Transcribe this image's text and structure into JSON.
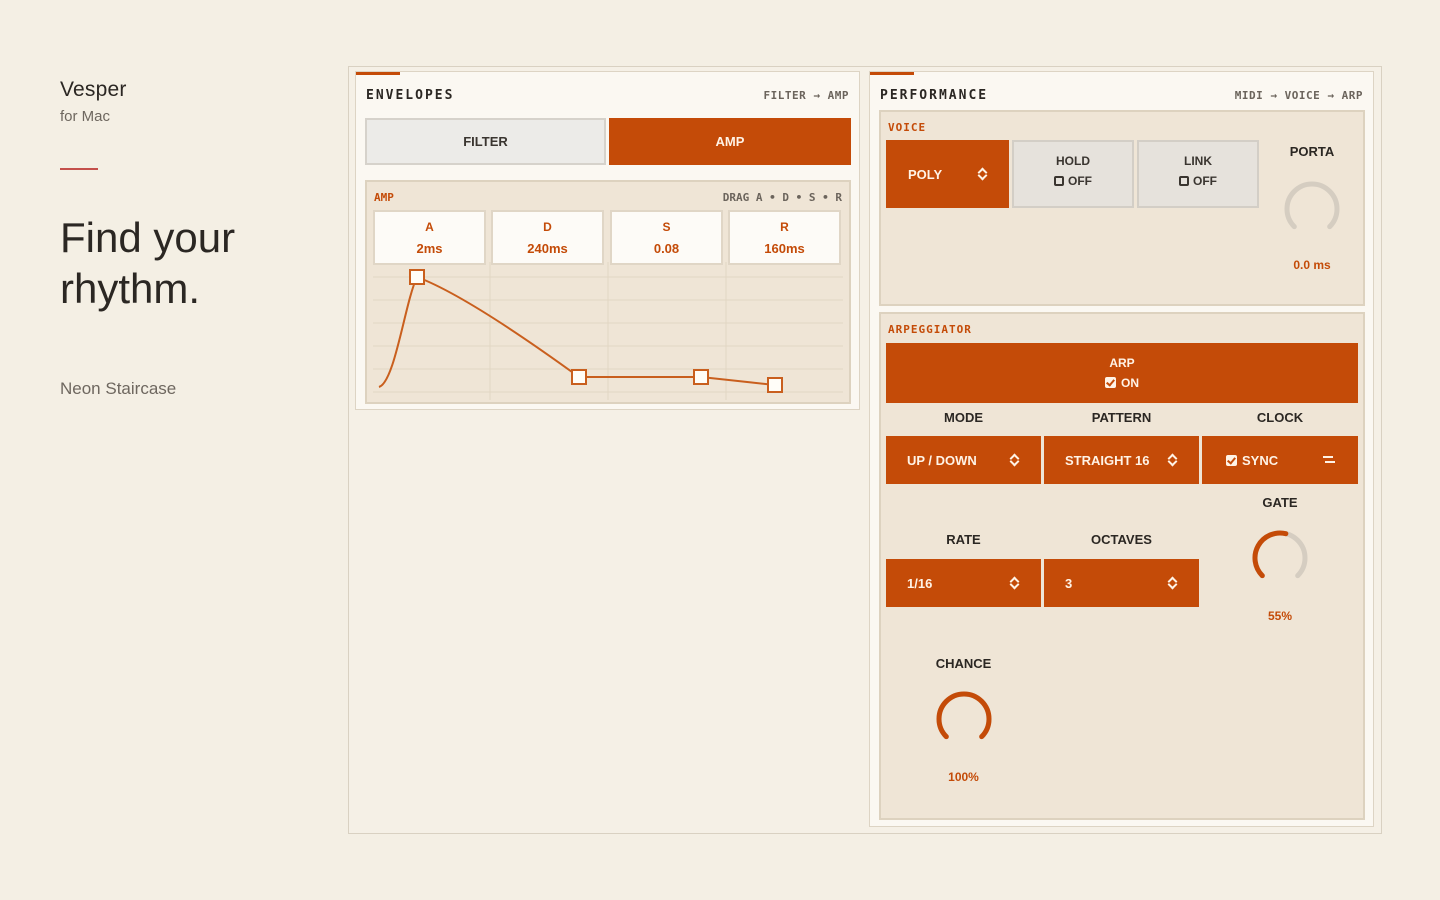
{
  "brand": {
    "name": "Vesper",
    "platform": "for Mac"
  },
  "headline": {
    "line1": "Find your",
    "line2": "rhythm."
  },
  "preset_name": "Neon Staircase",
  "colors": {
    "accent": "#c44b08",
    "background": "#f4efe4",
    "rule": "#c4504b"
  },
  "envelopes": {
    "title": "ENVELOPES",
    "route": "FILTER → AMP",
    "tabs": [
      {
        "label": "FILTER",
        "active": false
      },
      {
        "label": "AMP",
        "active": true
      }
    ],
    "editor": {
      "label": "AMP",
      "hint": "DRAG A • D • S • R",
      "params": [
        {
          "key": "A",
          "value": "2ms"
        },
        {
          "key": "D",
          "value": "240ms"
        },
        {
          "key": "S",
          "value": "0.08"
        },
        {
          "key": "R",
          "value": "160ms"
        }
      ],
      "sustain_level": 0.08
    }
  },
  "performance": {
    "title": "PERFORMANCE",
    "route": "MIDI → VOICE → ARP",
    "voice": {
      "label": "VOICE",
      "mode": "POLY",
      "hold": {
        "label": "HOLD",
        "state": "OFF"
      },
      "link": {
        "label": "LINK",
        "state": "OFF"
      },
      "porta": {
        "label": "PORTA",
        "value": "0.0 ms",
        "level": 0.0
      }
    },
    "arpeggiator": {
      "label": "ARPEGGIATOR",
      "arp": {
        "label": "ARP",
        "state": "ON"
      },
      "mode": {
        "label": "MODE",
        "value": "UP / DOWN"
      },
      "pattern": {
        "label": "PATTERN",
        "value": "STRAIGHT 16"
      },
      "clock": {
        "label": "CLOCK",
        "value": "SYNC"
      },
      "rate": {
        "label": "RATE",
        "value": "1/16"
      },
      "octaves": {
        "label": "OCTAVES",
        "value": "3"
      },
      "gate": {
        "label": "GATE",
        "value": "55%",
        "level": 0.55
      },
      "chance": {
        "label": "CHANCE",
        "value": "100%",
        "level": 1.0
      }
    }
  }
}
